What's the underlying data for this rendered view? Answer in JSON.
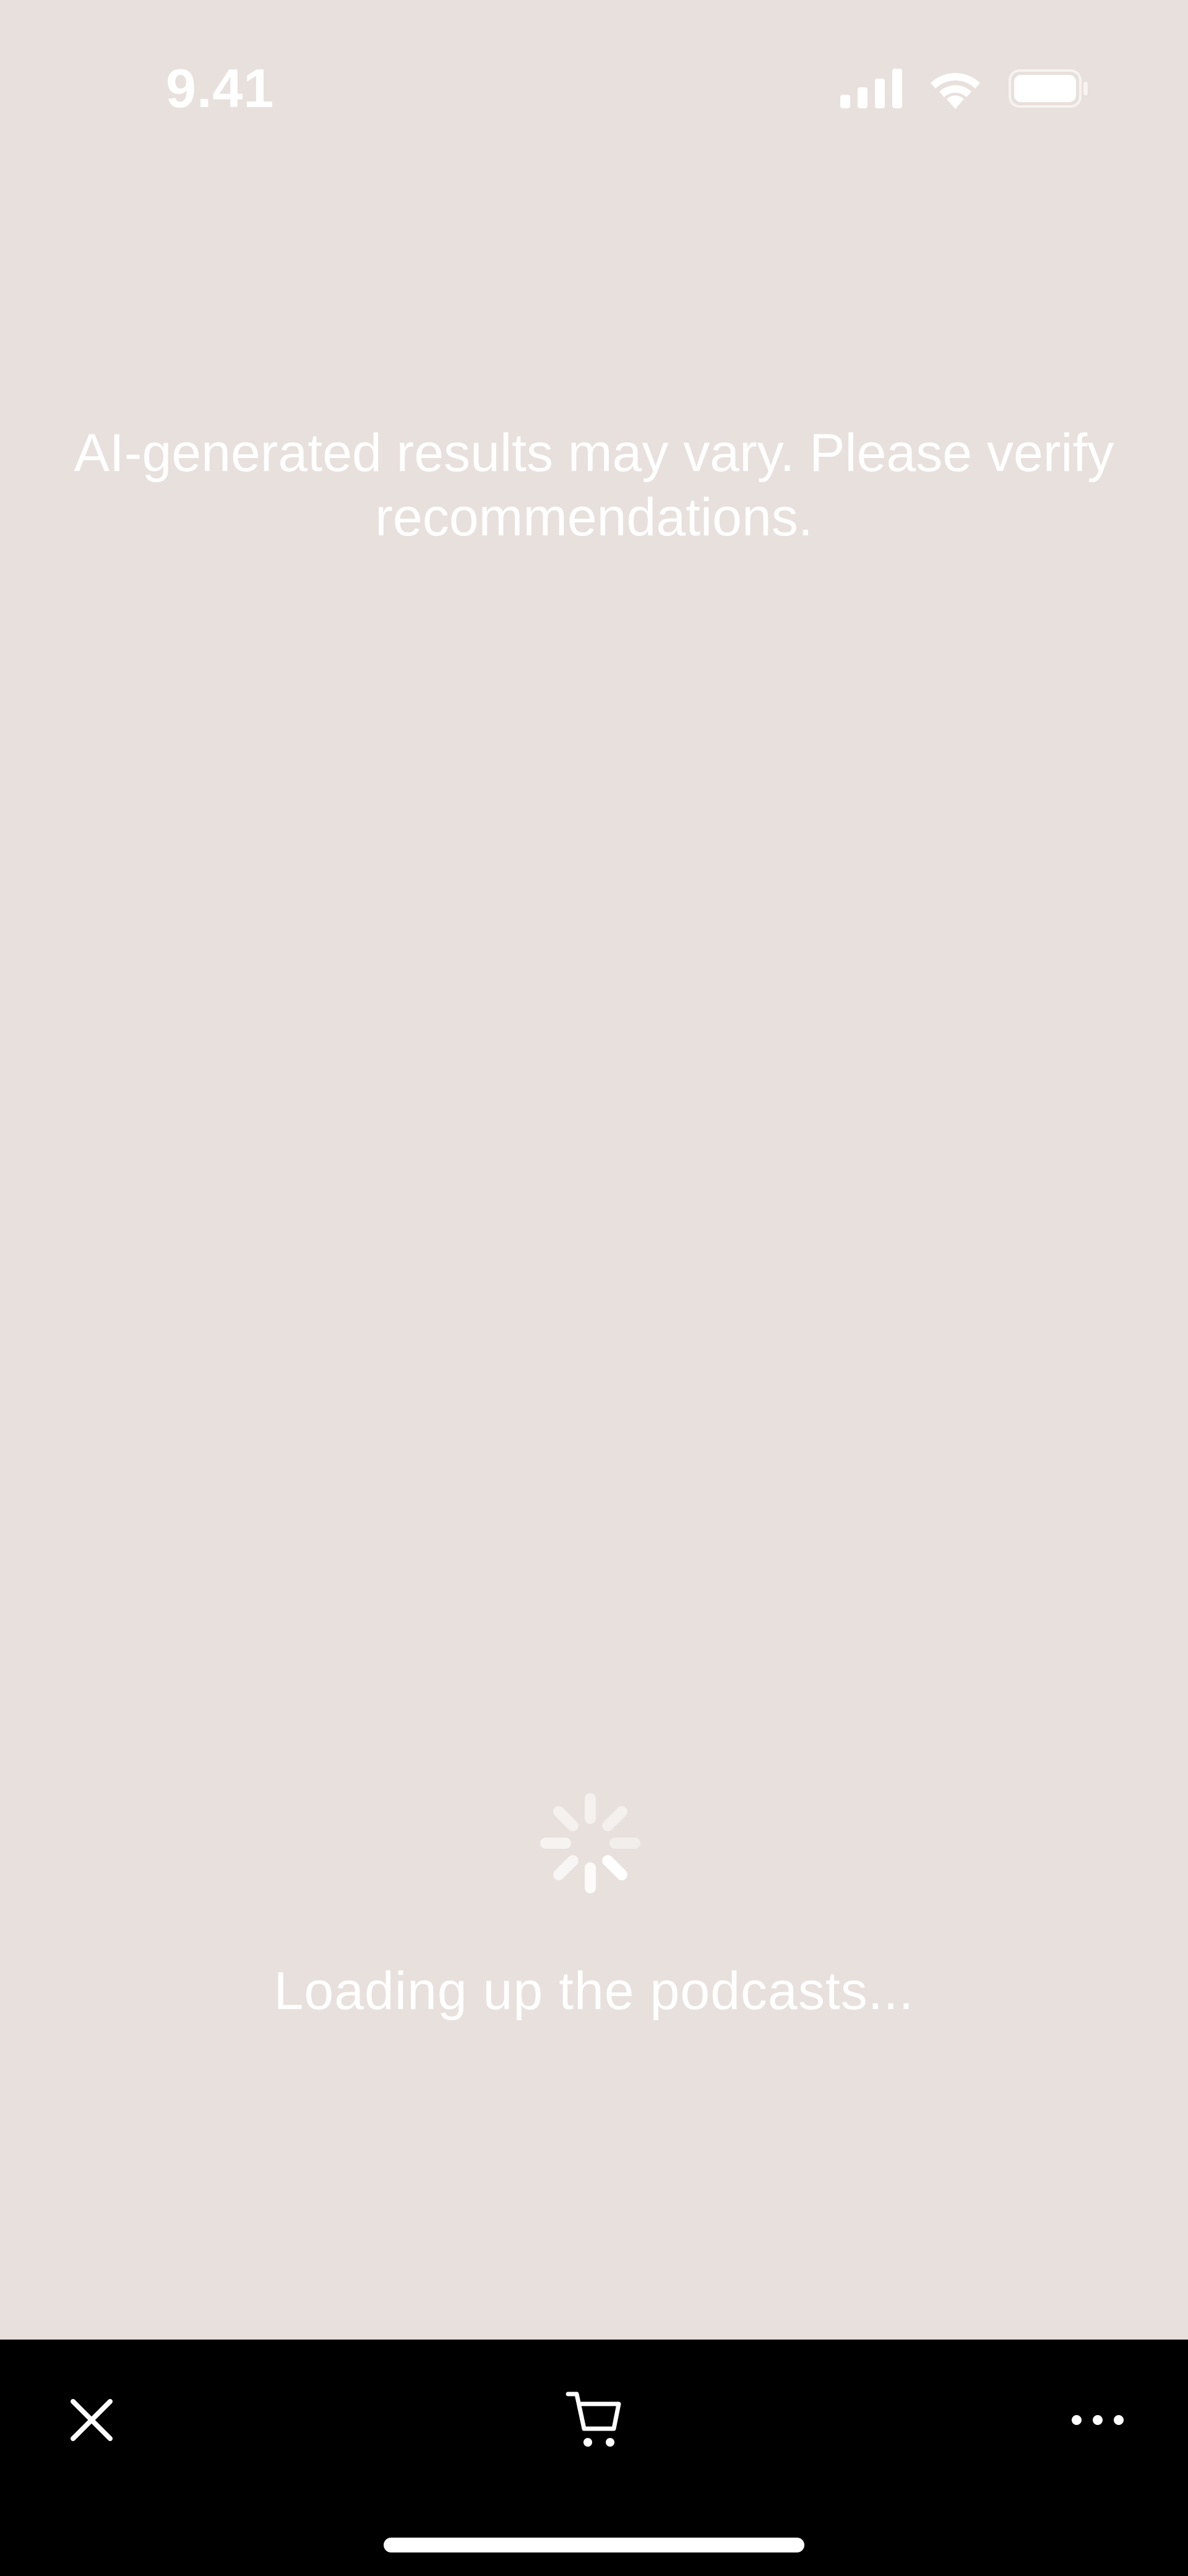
{
  "status_bar": {
    "time": "9.41",
    "icons": [
      "cellular-signal-icon",
      "wifi-icon",
      "battery-icon"
    ]
  },
  "disclaimer": {
    "text": "AI-generated results may vary. Please verify recommendations."
  },
  "loading": {
    "spinner_icon": "activity-spinner-icon",
    "text": "Loading up the podcasts..."
  },
  "bottom_bar": {
    "icons": [
      "close-icon",
      "cart-icon",
      "more-icon"
    ]
  },
  "colors": {
    "background": "#e8e0dc",
    "text": "#ffffff",
    "bottom_bar": "#000000"
  }
}
